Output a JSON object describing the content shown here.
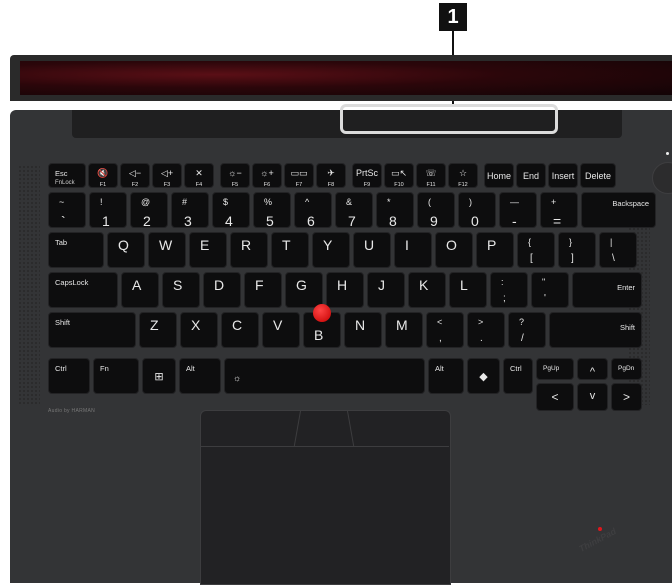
{
  "callout": {
    "number": "1"
  },
  "brand": {
    "speaker": "Audio by HARMAN",
    "logo": "ThinkPad"
  },
  "fn_row": [
    {
      "top": "Esc",
      "bottom": "FnLock"
    },
    {
      "icon": "🔇",
      "bottom": "F1"
    },
    {
      "icon": "◁−",
      "bottom": "F2"
    },
    {
      "icon": "◁+",
      "bottom": "F3"
    },
    {
      "icon": "✕",
      "bottom": "F4"
    },
    {
      "icon": "☼−",
      "bottom": "F5"
    },
    {
      "icon": "☼+",
      "bottom": "F6"
    },
    {
      "icon": "▭▭",
      "bottom": "F7"
    },
    {
      "icon": "✈",
      "bottom": "F8"
    },
    {
      "icon": "PrtSc",
      "bottom": "F9"
    },
    {
      "icon": "▭↖",
      "bottom": "F10"
    },
    {
      "icon": "☏",
      "bottom": "F11"
    },
    {
      "icon": "☆",
      "bottom": "F12"
    },
    {
      "label": "Home"
    },
    {
      "label": "End"
    },
    {
      "label": "Insert"
    },
    {
      "label": "Delete"
    }
  ],
  "number_row": [
    {
      "top": "~",
      "bottom": "`"
    },
    {
      "top": "!",
      "bottom": "1"
    },
    {
      "top": "@",
      "bottom": "2"
    },
    {
      "top": "#",
      "bottom": "3"
    },
    {
      "top": "$",
      "bottom": "4"
    },
    {
      "top": "%",
      "bottom": "5"
    },
    {
      "top": "^",
      "bottom": "6"
    },
    {
      "top": "&",
      "bottom": "7"
    },
    {
      "top": "*",
      "bottom": "8"
    },
    {
      "top": "(",
      "bottom": "9"
    },
    {
      "top": ")",
      "bottom": "0"
    },
    {
      "top": "—",
      "bottom": "-"
    },
    {
      "top": "+",
      "bottom": "="
    },
    {
      "label": "Backspace"
    }
  ],
  "row_q": {
    "tab": "Tab",
    "letters": [
      "Q",
      "W",
      "E",
      "R",
      "T",
      "Y",
      "U",
      "I",
      "O",
      "P"
    ],
    "brackets": [
      {
        "top": "{",
        "bottom": "["
      },
      {
        "top": "}",
        "bottom": "]"
      },
      {
        "top": "|",
        "bottom": "\\"
      }
    ]
  },
  "row_a": {
    "caps": "CapsLock",
    "letters": [
      "A",
      "S",
      "D",
      "F",
      "G",
      "H",
      "J",
      "K",
      "L"
    ],
    "punct": [
      {
        "top": ":",
        "bottom": ";"
      },
      {
        "top": "\"",
        "bottom": "'"
      }
    ],
    "enter": "Enter"
  },
  "row_z": {
    "shift_left": "Shift",
    "letters": [
      "Z",
      "X",
      "C",
      "V",
      "B",
      "N",
      "M"
    ],
    "punct": [
      {
        "top": "<",
        "bottom": ","
      },
      {
        "top": ">",
        "bottom": "."
      },
      {
        "top": "?",
        "bottom": "/"
      }
    ],
    "shift_right": "Shift"
  },
  "bottom_row": {
    "ctrl_left": "Ctrl",
    "fn": "Fn",
    "win": "⊞",
    "alt_left": "Alt",
    "space_icon": "☼",
    "alt_right": "Alt",
    "copilot": "◆",
    "ctrl_right": "Ctrl",
    "pgup": "PgUp",
    "pgdn": "PgDn",
    "up": "^",
    "left": "<",
    "down": "v",
    "right": ">"
  }
}
